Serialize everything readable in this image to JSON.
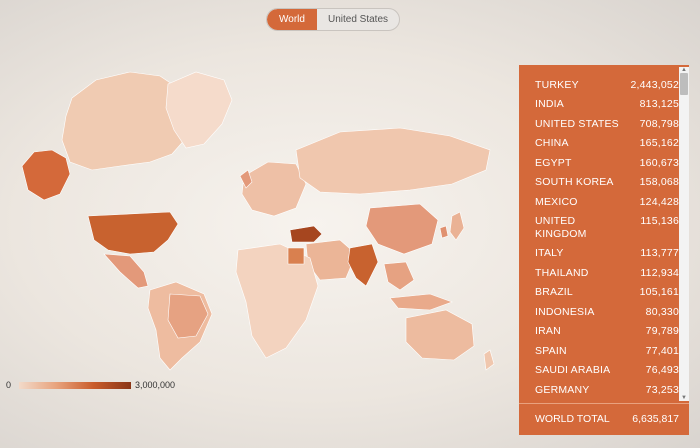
{
  "toggle": {
    "world_label": "World",
    "us_label": "United States",
    "selected": "World"
  },
  "legend": {
    "min_label": "0",
    "max_label": "3,000,000"
  },
  "colors": {
    "accent": "#d4693a",
    "highlight": "#a6461f",
    "light": "#f1d6c4",
    "mid": "#e8a98a"
  },
  "countries": [
    {
      "name": "TURKEY",
      "value": "2,443,052"
    },
    {
      "name": "INDIA",
      "value": "813,125"
    },
    {
      "name": "UNITED STATES",
      "value": "708,798"
    },
    {
      "name": "CHINA",
      "value": "165,162"
    },
    {
      "name": "EGYPT",
      "value": "160,673"
    },
    {
      "name": "SOUTH KOREA",
      "value": "158,068"
    },
    {
      "name": "MEXICO",
      "value": "124,428"
    },
    {
      "name": "UNITED KINGDOM",
      "value": "115,136"
    },
    {
      "name": "ITALY",
      "value": "113,777"
    },
    {
      "name": "THAILAND",
      "value": "112,934"
    },
    {
      "name": "BRAZIL",
      "value": "105,161"
    },
    {
      "name": "INDONESIA",
      "value": "80,330"
    },
    {
      "name": "IRAN",
      "value": "79,789"
    },
    {
      "name": "SPAIN",
      "value": "77,401"
    },
    {
      "name": "SAUDI ARABIA",
      "value": "76,493"
    },
    {
      "name": "GERMANY",
      "value": "73,253"
    }
  ],
  "total": {
    "label": "WORLD TOTAL",
    "value": "6,635,817"
  }
}
